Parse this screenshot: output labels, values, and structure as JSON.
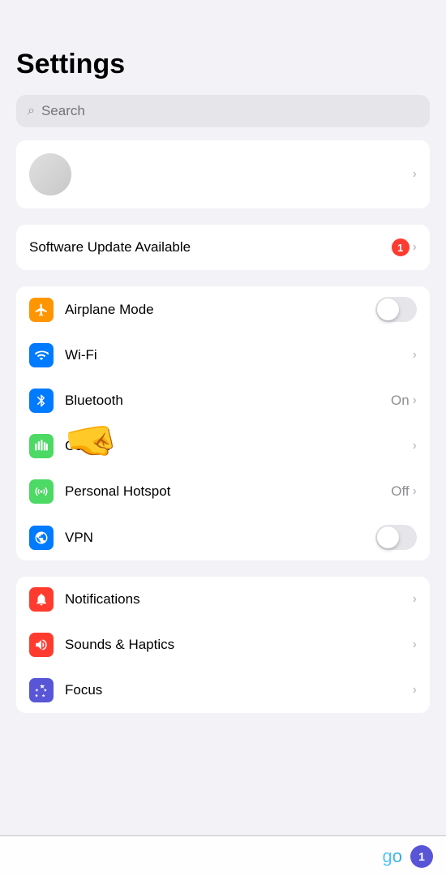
{
  "page": {
    "title": "Settings",
    "search_placeholder": "Search"
  },
  "profile_section": {
    "chevron": "›"
  },
  "software_update": {
    "label": "Software Update Available",
    "badge": "1",
    "chevron": "›"
  },
  "network_section": [
    {
      "id": "airplane-mode",
      "label": "Airplane Mode",
      "icon_color": "#ff9500",
      "right_type": "toggle",
      "toggle_on": false
    },
    {
      "id": "wifi",
      "label": "Wi-Fi",
      "icon_color": "#007aff",
      "right_type": "chevron",
      "right_text": ""
    },
    {
      "id": "bluetooth",
      "label": "Bluetooth",
      "icon_color": "#007aff",
      "right_type": "chevron",
      "right_text": "On"
    },
    {
      "id": "cellular",
      "label": "Cellular",
      "icon_color": "#4cd964",
      "right_type": "chevron",
      "right_text": ""
    },
    {
      "id": "personal-hotspot",
      "label": "Personal Hotspot",
      "icon_color": "#4cd964",
      "right_type": "chevron",
      "right_text": "Off"
    },
    {
      "id": "vpn",
      "label": "VPN",
      "icon_color": "#007aff",
      "right_type": "toggle",
      "toggle_on": false
    }
  ],
  "system_section": [
    {
      "id": "notifications",
      "label": "Notifications",
      "icon_color": "#ff3b30",
      "right_type": "chevron"
    },
    {
      "id": "sounds-haptics",
      "label": "Sounds & Haptics",
      "icon_color": "#ff3b30",
      "right_type": "chevron"
    },
    {
      "id": "focus",
      "label": "Focus",
      "icon_color": "#5856d6",
      "right_type": "chevron"
    }
  ],
  "bottom_bar": {
    "go_text": "go",
    "badge": "1"
  }
}
